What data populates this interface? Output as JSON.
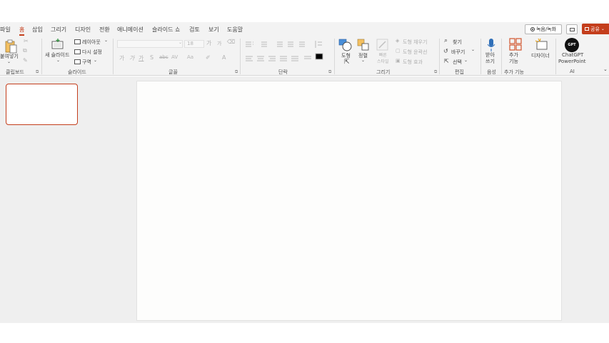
{
  "menu": {
    "tabs": [
      "파일",
      "홈",
      "삽입",
      "그리기",
      "디자인",
      "전환",
      "애니메이션",
      "슬라이드 쇼",
      "검토",
      "보기",
      "도움말"
    ],
    "active_tab": "홈"
  },
  "header_buttons": {
    "record": "녹음/녹화",
    "share": "공유"
  },
  "ribbon": {
    "clipboard": {
      "paste": "붙여넣기",
      "label": "클립보드"
    },
    "slides": {
      "new_slide": "새 슬라이드",
      "layout": "레이아웃",
      "reset": "다시 설정",
      "section": "구역",
      "label": "슬라이드"
    },
    "font": {
      "label": "글꼴",
      "size": "18",
      "bold": "가",
      "italic": "가",
      "underline": "가",
      "shadow": "S",
      "strike": "abc",
      "spacing": "AV",
      "case": "Aa",
      "grow": "가",
      "shrink": "가"
    },
    "paragraph": {
      "label": "단락"
    },
    "drawing": {
      "shapes": "도형",
      "arrange": "정렬",
      "quick_styles": "빠른\n스타일",
      "fill": "도형 채우기",
      "outline": "도형 윤곽선",
      "effects": "도형 효과",
      "label": "그리기"
    },
    "editing": {
      "find": "찾기",
      "replace": "바꾸기",
      "select": "선택",
      "label": "편집"
    },
    "voice": {
      "dictate": "받아\n쓰기",
      "label": "음성"
    },
    "addins": {
      "addins": "추가\n기능",
      "label": "추가 기능"
    },
    "designer": {
      "designer": "디자이너"
    },
    "ai": {
      "chatgpt_line1": "ChatGPT",
      "chatgpt_line2": "PowerPoint",
      "chatgpt_icon_text": "GPT",
      "label": "AI"
    }
  },
  "colors": {
    "accent": "#c43e1c",
    "ribbon_bg": "#f3f3f3",
    "workspace_bg": "#efefef"
  }
}
